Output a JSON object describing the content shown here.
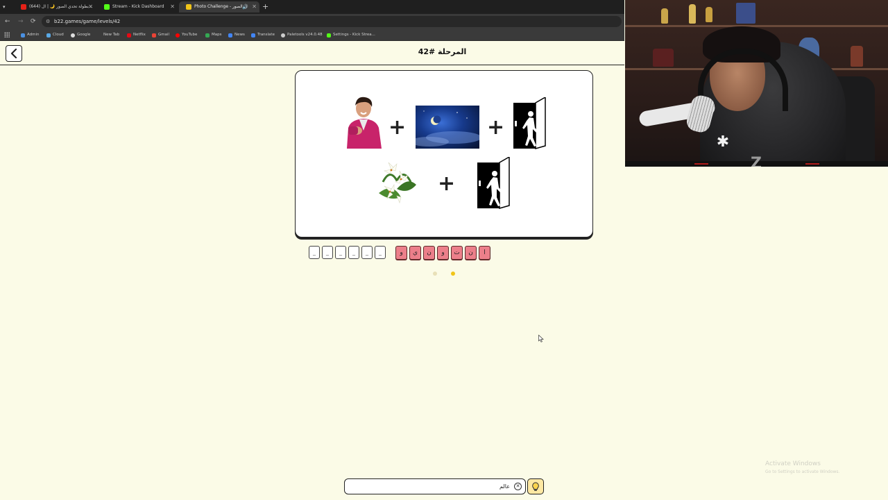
{
  "browser": {
    "tabs": [
      {
        "title": "(644) بطولة تحدي الصور 🌙 | ال...",
        "favicon_color": "#e62117",
        "active": false
      },
      {
        "title": "Stream - Kick Dashboard",
        "favicon_color": "#53fc18",
        "active": false
      },
      {
        "title": "Photo Challenge - ي الصور",
        "favicon_color": "#f0c419",
        "active": true
      }
    ],
    "url": "b22.games/game/levels/42",
    "bookmarks": [
      {
        "label": "Admin",
        "color": "#4a90e2"
      },
      {
        "label": "Cloud",
        "color": "#5aa9e6"
      },
      {
        "label": "Google",
        "color": "#dddddd"
      },
      {
        "label": "New Tab",
        "color": "#3a3a3a"
      },
      {
        "label": "Netflix",
        "color": "#e50914"
      },
      {
        "label": "Gmail",
        "color": "#ea4335"
      },
      {
        "label": "YouTube",
        "color": "#ff0000"
      },
      {
        "label": "Maps",
        "color": "#34a853"
      },
      {
        "label": "News",
        "color": "#4285f4"
      },
      {
        "label": "Translate",
        "color": "#4285f4"
      },
      {
        "label": "Paletools v24.0.48",
        "color": "#cccccc"
      },
      {
        "label": "Settings - Kick Strea...",
        "color": "#53fc18"
      }
    ]
  },
  "game": {
    "level_title": "المرحلة #42",
    "puzzle_icons": [
      "man-pointing-image",
      "night-sky-image",
      "exit-door-icon",
      "lily-flower-image",
      "exit-door-icon"
    ],
    "answer_slots_empty": [
      "_",
      "_",
      "_",
      "_",
      "_",
      "_"
    ],
    "answer_letters": [
      "ا",
      "ن",
      "ت",
      "و",
      "ن",
      "ي",
      "و"
    ],
    "progress_dots": [
      {
        "state": "inactive",
        "color": "#e8e0b8"
      },
      {
        "state": "active",
        "color": "#f0c419"
      }
    ],
    "guess_value": "عالم",
    "guess_placeholder": ""
  },
  "os": {
    "activate_title": "Activate Windows",
    "activate_subtitle": "Go to Settings to activate Windows."
  }
}
